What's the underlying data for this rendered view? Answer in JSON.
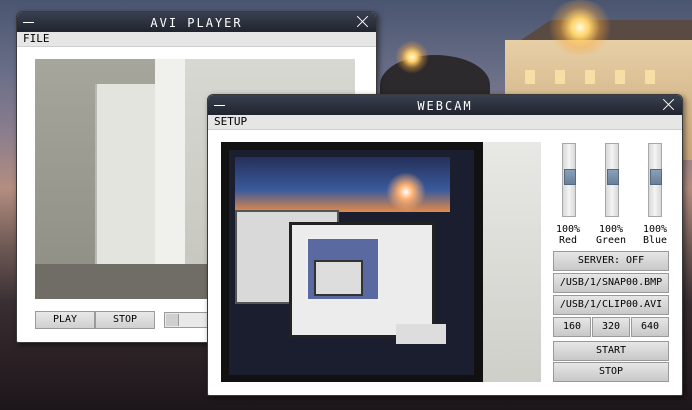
{
  "colors": {
    "titlebar": "#20242e",
    "window_bg": "#ffffff",
    "button_bg": "#d8d8d8",
    "slider_thumb": "#7a8fa8"
  },
  "avi_player": {
    "title": "AVI PLAYER",
    "menu": [
      "FILE"
    ],
    "buttons": {
      "play": "PLAY",
      "stop": "STOP"
    },
    "seek_position": 0.0
  },
  "webcam": {
    "title": "WEBCAM",
    "menu": [
      "SETUP"
    ],
    "sliders": [
      {
        "value": "100%",
        "label": "Red",
        "level": 0.55
      },
      {
        "value": "100%",
        "label": "Green",
        "level": 0.55
      },
      {
        "value": "100%",
        "label": "Blue",
        "level": 0.55
      }
    ],
    "server_button": "SERVER: OFF",
    "snap_path": "/USB/1/SNAP00.BMP",
    "clip_path": "/USB/1/CLIP00.AVI",
    "resolutions": [
      "160",
      "320",
      "640"
    ],
    "start": "START",
    "stop": "STOP"
  },
  "icons": {
    "minimize": "minimize-icon",
    "close": "close-icon"
  }
}
